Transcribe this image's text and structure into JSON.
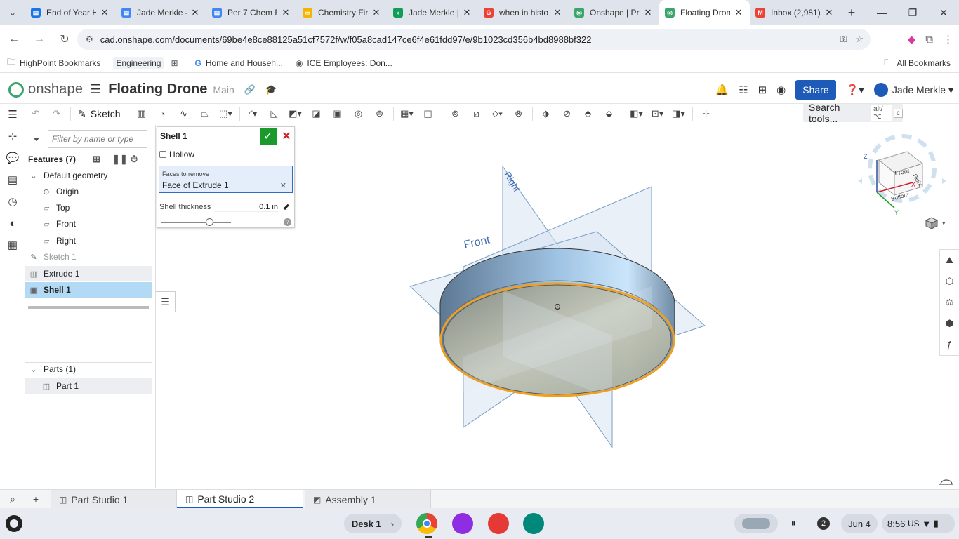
{
  "browser": {
    "tabs": [
      {
        "title": "End of Year H",
        "fav_color": "#1a73e8",
        "fav_glyph": "▤",
        "active": false
      },
      {
        "title": "Jade Merkle -",
        "fav_color": "#4285f4",
        "fav_glyph": "▤",
        "active": false
      },
      {
        "title": "Per 7 Chem F",
        "fav_color": "#4285f4",
        "fav_glyph": "▤",
        "active": false
      },
      {
        "title": "Chemistry Fir",
        "fav_color": "#f4b400",
        "fav_glyph": "▭",
        "active": false
      },
      {
        "title": "Jade Merkle |",
        "fav_color": "#0f9d58",
        "fav_glyph": "»",
        "active": false
      },
      {
        "title": "when in histo",
        "fav_color": "#ea4335",
        "fav_glyph": "G",
        "active": false
      },
      {
        "title": "Onshape | Pr",
        "fav_color": "#3aa66b",
        "fav_glyph": "◎",
        "active": false
      },
      {
        "title": "Floating Dron",
        "fav_color": "#3aa66b",
        "fav_glyph": "◎",
        "active": true
      },
      {
        "title": "Inbox (2,981)",
        "fav_color": "#ea4335",
        "fav_glyph": "M",
        "active": false
      }
    ],
    "new_tab": "+",
    "url": "cad.onshape.com/documents/69be4e8ce88125a51cf7572f/w/f05a8cad147ce6f4e61fdd97/e/9b1023cd356b4bd8988bf322",
    "bookmarks": [
      {
        "label": "HighPoint Bookmarks",
        "icon": "folder-icon"
      },
      {
        "label": "Engineering",
        "icon": "tag"
      },
      {
        "label": "Home and Househ...",
        "icon": "google-icon"
      },
      {
        "label": "ICE Employees: Don...",
        "icon": "link-icon"
      }
    ],
    "bookmarks_right": "All Bookmarks"
  },
  "onshape": {
    "brand": "onshape",
    "doc_title": "Floating Drone",
    "branch": "Main",
    "share_label": "Share",
    "help_label": "?",
    "user_name": "Jade Merkle",
    "sketch_label": "Sketch",
    "search_tools_label": "Search tools...",
    "search_tools_kbd": "alt/⌥",
    "search_tools_kbd2": "c"
  },
  "features": {
    "filter_placeholder": "Filter by name or type",
    "header": "Features (7)",
    "default_geometry": "Default geometry",
    "items": [
      "Origin",
      "Top",
      "Front",
      "Right",
      "Sketch 1",
      "Extrude 1",
      "Shell 1"
    ],
    "parts_header": "Parts (1)",
    "parts": [
      "Part 1"
    ]
  },
  "shell_dialog": {
    "title": "Shell 1",
    "hollow_label": "Hollow",
    "hollow_checked": false,
    "faces_label": "Faces to remove",
    "faces_value": "Face of Extrude 1",
    "thickness_label": "Shell thickness",
    "thickness_value": "0.1 in",
    "help": "?"
  },
  "viewport": {
    "plane_front": "Front",
    "plane_right": "Right",
    "view_cube": {
      "front": "Front",
      "right": "Right",
      "bottom": "Bottom",
      "z": "Z",
      "x": "X",
      "y": "Y"
    }
  },
  "bottom_tabs": [
    "Part Studio 1",
    "Part Studio 2",
    "Assembly 1"
  ],
  "active_bottom_tab": "Part Studio 2",
  "shelf": {
    "desk_label": "Desk 1",
    "notifications": "2",
    "date": "Jun 4",
    "time": "8:56",
    "locale": "US"
  }
}
